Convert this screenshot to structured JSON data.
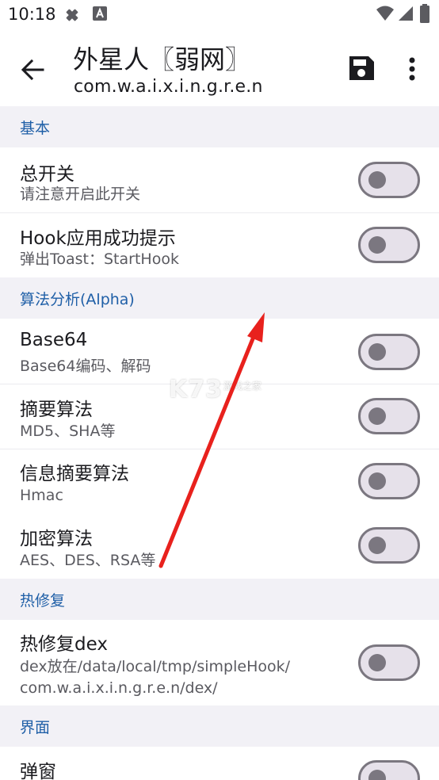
{
  "status_bar": {
    "time": "10:18"
  },
  "app_bar": {
    "title": "外星人〖弱网〗",
    "subtitle": "com.w.a.i.x.i.n.g.r.e.n"
  },
  "sections": {
    "basic": {
      "header": "基本",
      "items": [
        {
          "title": "总开关",
          "subtitle": "请注意开启此开关",
          "enabled": false
        },
        {
          "title": "Hook应用成功提示",
          "subtitle": "弹出Toast：StartHook",
          "enabled": false
        }
      ]
    },
    "algorithm": {
      "header": "算法分析(Alpha)",
      "items": [
        {
          "title": "Base64",
          "subtitle": "Base64编码、解码",
          "enabled": false
        },
        {
          "title": "摘要算法",
          "subtitle": "MD5、SHA等",
          "enabled": false
        },
        {
          "title": "信息摘要算法",
          "subtitle": "Hmac",
          "enabled": false
        },
        {
          "title": "加密算法",
          "subtitle": "AES、DES、RSA等",
          "enabled": false
        }
      ]
    },
    "hotfix": {
      "header": "热修复",
      "items": [
        {
          "title": "热修复dex",
          "subtitle_line1": "dex放在/data/local/tmp/simpleHook/",
          "subtitle_line2": "com.w.a.i.x.i.n.g.r.e.n/dex/",
          "enabled": false
        }
      ]
    },
    "ui": {
      "header": "界面",
      "items": [
        {
          "title": "弹窗",
          "enabled": false
        }
      ]
    }
  },
  "watermark": {
    "logo": "K73",
    "tagline": "游戏之家"
  },
  "colors": {
    "section_text": "#1f5fa7",
    "section_bg": "#f2f1f6",
    "switch_track": "#e6e1ea",
    "switch_outline": "#7b7780",
    "arrow": "#e8211d"
  }
}
